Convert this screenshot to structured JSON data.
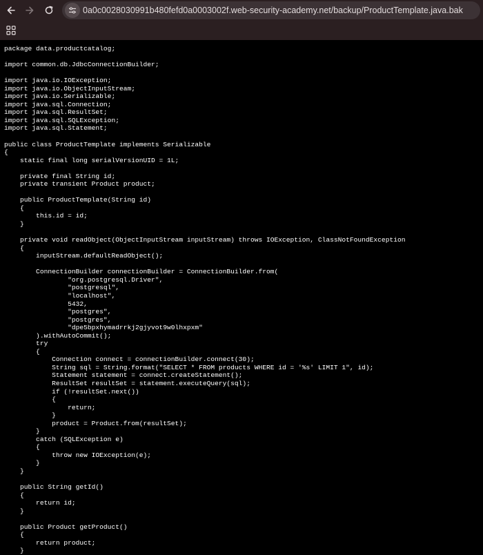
{
  "browser": {
    "url": "0a0c0028030991b480fefd0a0003002f.web-security-academy.net/backup/ProductTemplate.java.bak",
    "icons": {
      "back": "arrow-left-icon",
      "forward": "arrow-right-icon",
      "reload": "reload-icon",
      "site_info": "tune-icon",
      "apps": "apps-grid-icon"
    },
    "colors": {
      "chrome_bg": "#2b1f21",
      "omnibox_bg": "#3c3235",
      "page_bg": "#000000",
      "text": "#ffffff"
    }
  },
  "file": {
    "lines": [
      "package data.productcatalog;",
      "",
      "import common.db.JdbcConnectionBuilder;",
      "",
      "import java.io.IOException;",
      "import java.io.ObjectInputStream;",
      "import java.io.Serializable;",
      "import java.sql.Connection;",
      "import java.sql.ResultSet;",
      "import java.sql.SQLException;",
      "import java.sql.Statement;",
      "",
      "public class ProductTemplate implements Serializable",
      "{",
      "    static final long serialVersionUID = 1L;",
      "",
      "    private final String id;",
      "    private transient Product product;",
      "",
      "    public ProductTemplate(String id)",
      "    {",
      "        this.id = id;",
      "    }",
      "",
      "    private void readObject(ObjectInputStream inputStream) throws IOException, ClassNotFoundException",
      "    {",
      "        inputStream.defaultReadObject();",
      "",
      "        ConnectionBuilder connectionBuilder = ConnectionBuilder.from(",
      "                \"org.postgresql.Driver\",",
      "                \"postgresql\",",
      "                \"localhost\",",
      "                5432,",
      "                \"postgres\",",
      "                \"postgres\",",
      "                \"dpe5bpxhymadrrkj2gjyvot9w0lhxpxm\"",
      "        ).withAutoCommit();",
      "        try",
      "        {",
      "            Connection connect = connectionBuilder.connect(30);",
      "            String sql = String.format(\"SELECT * FROM products WHERE id = '%s' LIMIT 1\", id);",
      "            Statement statement = connect.createStatement();",
      "            ResultSet resultSet = statement.executeQuery(sql);",
      "            if (!resultSet.next())",
      "            {",
      "                return;",
      "            }",
      "            product = Product.from(resultSet);",
      "        }",
      "        catch (SQLException e)",
      "        {",
      "            throw new IOException(e);",
      "        }",
      "    }",
      "",
      "    public String getId()",
      "    {",
      "        return id;",
      "    }",
      "",
      "    public Product getProduct()",
      "    {",
      "        return product;",
      "    }"
    ]
  }
}
